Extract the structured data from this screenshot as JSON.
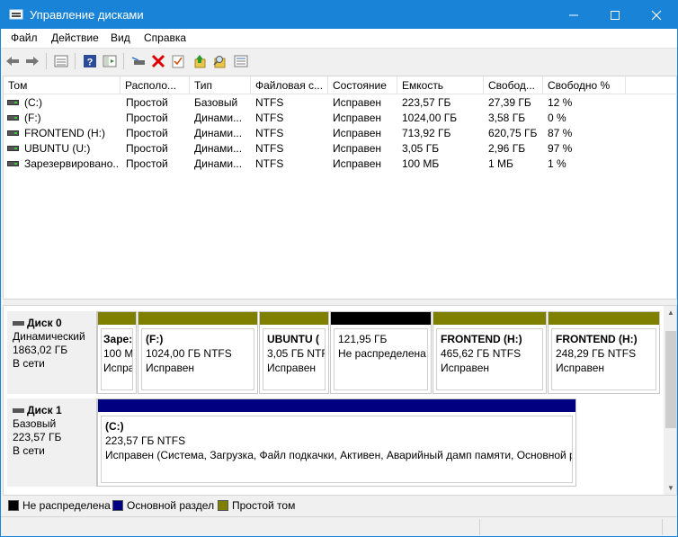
{
  "window": {
    "title": "Управление дисками"
  },
  "menu": [
    "Файл",
    "Действие",
    "Вид",
    "Справка"
  ],
  "toolbar_icons": [
    "back-arrow-icon",
    "forward-arrow-icon",
    "properties-icon",
    "help-icon",
    "show-hide-pane-icon",
    "connect-disk-icon",
    "delete-icon",
    "check-icon",
    "refresh-up-icon",
    "search-icon",
    "list-icon"
  ],
  "columns": [
    "Том",
    "Располо...",
    "Тип",
    "Файловая с...",
    "Состояние",
    "Емкость",
    "Свобод...",
    "Свободно %"
  ],
  "volumes": [
    {
      "name": "(C:)",
      "layout": "Простой",
      "type": "Базовый",
      "fs": "NTFS",
      "status": "Исправен",
      "capacity": "223,57 ГБ",
      "free": "27,39 ГБ",
      "free_pct": "12 %"
    },
    {
      "name": "(F:)",
      "layout": "Простой",
      "type": "Динами...",
      "fs": "NTFS",
      "status": "Исправен",
      "capacity": "1024,00 ГБ",
      "free": "3,58 ГБ",
      "free_pct": "0 %"
    },
    {
      "name": "FRONTEND (H:)",
      "layout": "Простой",
      "type": "Динами...",
      "fs": "NTFS",
      "status": "Исправен",
      "capacity": "713,92 ГБ",
      "free": "620,75 ГБ",
      "free_pct": "87 %"
    },
    {
      "name": "UBUNTU (U:)",
      "layout": "Простой",
      "type": "Динами...",
      "fs": "NTFS",
      "status": "Исправен",
      "capacity": "3,05 ГБ",
      "free": "2,96 ГБ",
      "free_pct": "97 %"
    },
    {
      "name": "Зарезервировано...",
      "layout": "Простой",
      "type": "Динами...",
      "fs": "NTFS",
      "status": "Исправен",
      "capacity": "100 МБ",
      "free": "1 МБ",
      "free_pct": "1 %"
    }
  ],
  "disks": [
    {
      "name": "Диск 0",
      "type": "Динамический",
      "size": "1863,02 ГБ",
      "state": "В сети",
      "partitions": [
        {
          "name": "Заре:",
          "line1": "100 М",
          "line2": "Испра",
          "bar_color": "#808000"
        },
        {
          "name": "(F:)",
          "line1": "1024,00 ГБ NTFS",
          "line2": "Исправен",
          "bar_color": "#808000"
        },
        {
          "name": "UBUNTU  (",
          "line1": "3,05 ГБ NTF",
          "line2": "Исправен",
          "bar_color": "#808000"
        },
        {
          "name": "",
          "line1": "121,95 ГБ",
          "line2": "Не распределена",
          "bar_color": "#000000"
        },
        {
          "name": "FRONTEND  (H:)",
          "line1": "465,62 ГБ NTFS",
          "line2": "Исправен",
          "bar_color": "#808000"
        },
        {
          "name": "FRONTEND  (H:)",
          "line1": "248,29 ГБ NTFS",
          "line2": "Исправен",
          "bar_color": "#808000"
        }
      ]
    },
    {
      "name": "Диск 1",
      "type": "Базовый",
      "size": "223,57 ГБ",
      "state": "В сети",
      "partitions": [
        {
          "name": "(C:)",
          "line1": "223,57 ГБ NTFS",
          "line2": "Исправен (Система, Загрузка, Файл подкачки, Активен, Аварийный дамп памяти, Основной р",
          "bar_color": "#000080"
        }
      ]
    }
  ],
  "legend": [
    {
      "label": "Не распределена",
      "color": "#000000"
    },
    {
      "label": "Основной раздел",
      "color": "#000080"
    },
    {
      "label": "Простой том",
      "color": "#808000"
    }
  ]
}
